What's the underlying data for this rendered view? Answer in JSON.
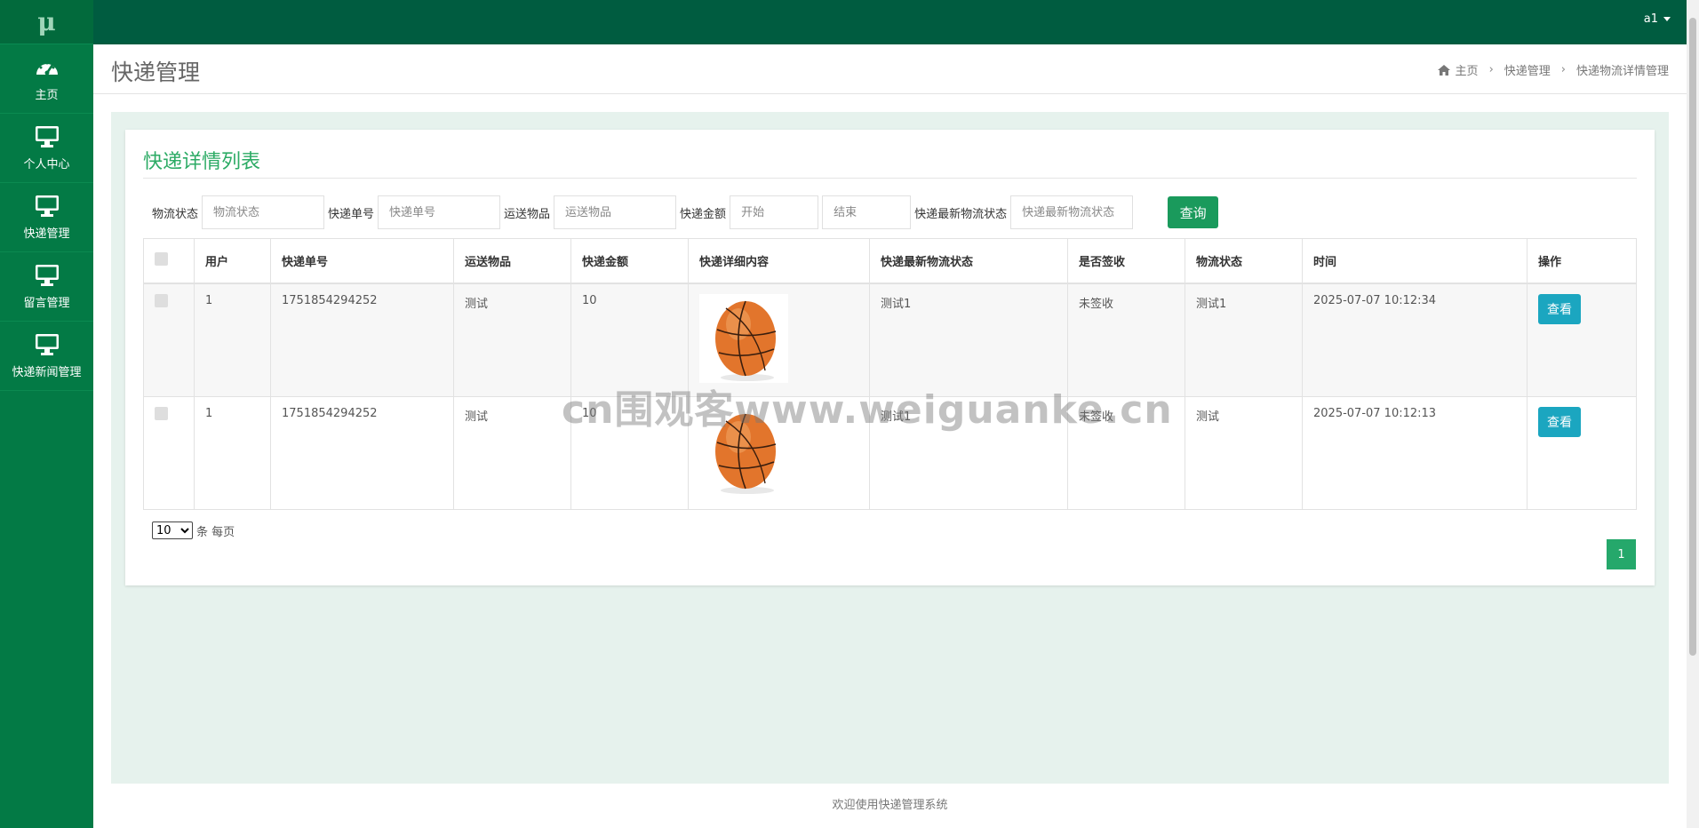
{
  "brand": "μ",
  "nav": [
    {
      "label": "主页",
      "icon": "dashboard-icon"
    },
    {
      "label": "个人中心",
      "icon": "monitor-icon"
    },
    {
      "label": "快递管理",
      "icon": "monitor-icon"
    },
    {
      "label": "留言管理",
      "icon": "monitor-icon"
    },
    {
      "label": "快递新闻管理",
      "icon": "monitor-icon"
    }
  ],
  "user": {
    "name": "a1"
  },
  "header": {
    "title": "快递管理",
    "breadcrumb": [
      "主页",
      "快递管理",
      "快递物流详情管理"
    ]
  },
  "card": {
    "title": "快递详情列表"
  },
  "search": {
    "status_label": "物流状态",
    "status_placeholder": "物流状态",
    "number_label": "快递单号",
    "number_placeholder": "快递单号",
    "item_label": "运送物品",
    "item_placeholder": "运送物品",
    "amount_label": "快递金额",
    "amount_start_placeholder": "开始",
    "amount_end_placeholder": "结束",
    "latest_label": "快递最新物流状态",
    "latest_placeholder": "快递最新物流状态",
    "query_button": "查询"
  },
  "table": {
    "columns": [
      "用户",
      "快递单号",
      "运送物品",
      "快递金额",
      "快递详细内容",
      "快递最新物流状态",
      "是否签收",
      "物流状态",
      "时间",
      "操作"
    ],
    "rows": [
      {
        "user": "1",
        "number": "1751854294252",
        "item": "测试",
        "amount": "10",
        "image": "basketball-image",
        "latest_status": "测试1",
        "signed": "未签收",
        "status": "测试1",
        "time": "2025-07-07 10:12:34",
        "action": "查看"
      },
      {
        "user": "1",
        "number": "1751854294252",
        "item": "测试",
        "amount": "10",
        "image": "basketball-image",
        "latest_status": "测试1",
        "signed": "未签收",
        "status": "测试",
        "time": "2025-07-07 10:12:13",
        "action": "查看"
      }
    ]
  },
  "pagination": {
    "page_size": "10",
    "page_size_options": [
      "10"
    ],
    "per_page_suffix": "条 每页",
    "current_page": "1"
  },
  "footer": "欢迎使用快递管理系统",
  "watermark": "cn围观客www.weiguanke.cn",
  "colors": {
    "sidebar": "#037a45",
    "topbar": "#005c40",
    "accent": "#2cab65",
    "view_button": "#1ba6c0"
  }
}
